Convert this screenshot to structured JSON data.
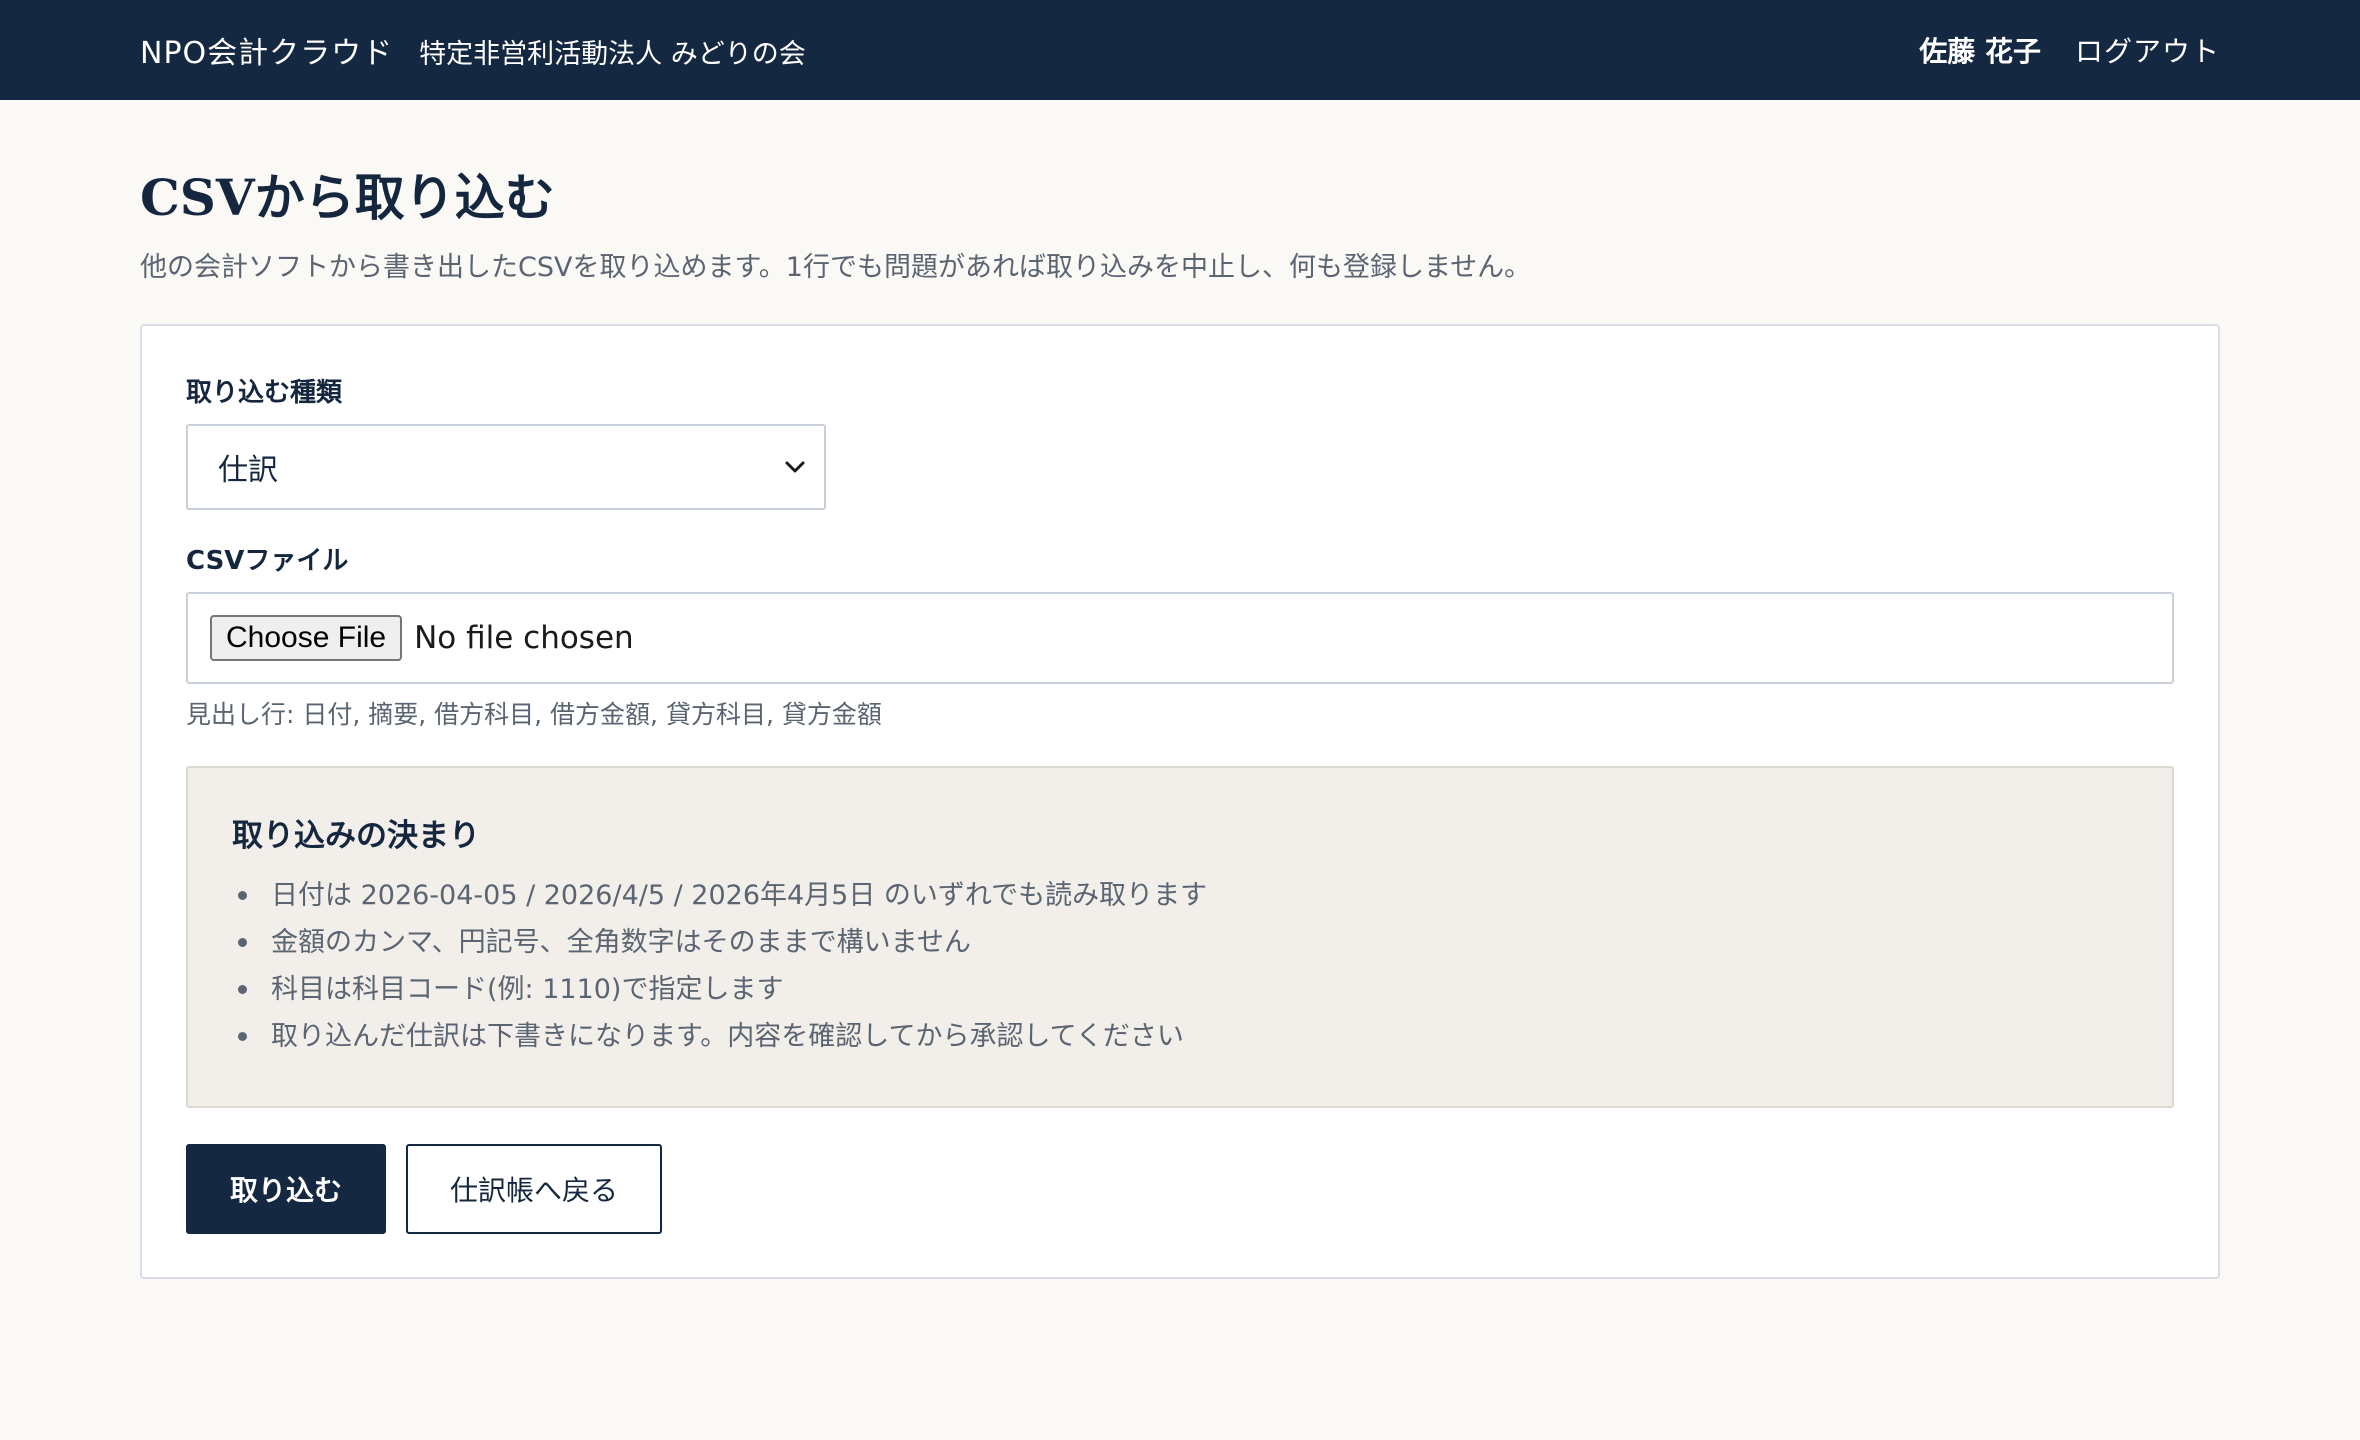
{
  "header": {
    "brand": "NPO会計クラウド",
    "organization": "特定非営利活動法人 みどりの会",
    "user_name": "佐藤 花子",
    "logout_label": "ログアウト"
  },
  "page": {
    "title": "CSVから取り込む",
    "description": "他の会計ソフトから書き出したCSVを取り込めます。1行でも問題があれば取り込みを中止し、何も登録しません。"
  },
  "form": {
    "type_label": "取り込む種類",
    "type_selected": "仕訳",
    "file_label": "CSVファイル",
    "file_button_label": "Choose File",
    "file_status": "No file chosen",
    "file_hint": "見出し行: 日付, 摘要, 借方科目, 借方金額, 貸方科目, 貸方金額"
  },
  "rules": {
    "title": "取り込みの決まり",
    "items": [
      "日付は 2026-04-05 / 2026/4/5 / 2026年4月5日 のいずれでも読み取ります",
      "金額のカンマ、円記号、全角数字はそのままで構いません",
      "科目は科目コード(例: 1110)で指定します",
      "取り込んだ仕訳は下書きになります。内容を確認してから承認してください"
    ]
  },
  "actions": {
    "submit_label": "取り込む",
    "back_label": "仕訳帳へ戻る"
  },
  "icons": {
    "select_arrow": "chevron-down-icon"
  }
}
